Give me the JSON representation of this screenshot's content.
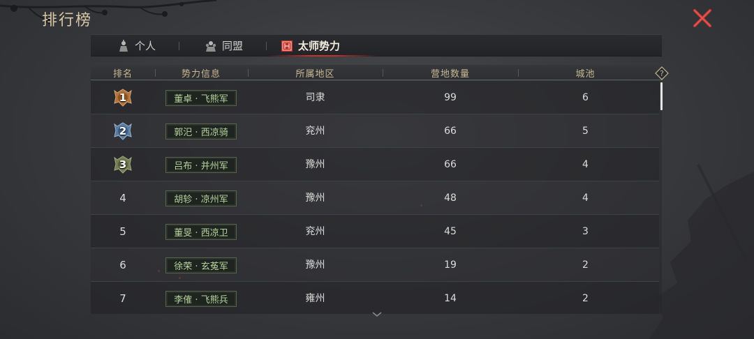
{
  "page": {
    "title": "排行榜"
  },
  "tabs": [
    {
      "label": "个人",
      "icon": "soldier-icon",
      "active": false
    },
    {
      "label": "同盟",
      "icon": "alliance-icon",
      "active": false
    },
    {
      "label": "太师势力",
      "icon": "banner-icon",
      "active": true
    }
  ],
  "table": {
    "headers": [
      "排名",
      "势力信息",
      "所属地区",
      "营地数量",
      "城池"
    ],
    "rows": [
      {
        "rank": "1",
        "medal": "gold",
        "force": "董卓 · 飞熊军",
        "region": "司隶",
        "camps": "99",
        "cities": "6"
      },
      {
        "rank": "2",
        "medal": "silver",
        "force": "郭汜 · 西凉骑",
        "region": "兖州",
        "camps": "66",
        "cities": "5"
      },
      {
        "rank": "3",
        "medal": "bronze",
        "force": "吕布 · 并州军",
        "region": "豫州",
        "camps": "66",
        "cities": "4"
      },
      {
        "rank": "4",
        "medal": "",
        "force": "胡轸 · 凉州军",
        "region": "豫州",
        "camps": "48",
        "cities": "4"
      },
      {
        "rank": "5",
        "medal": "",
        "force": "董旻 · 西凉卫",
        "region": "兖州",
        "camps": "45",
        "cities": "3"
      },
      {
        "rank": "6",
        "medal": "",
        "force": "徐荣 · 玄菟军",
        "region": "豫州",
        "camps": "19",
        "cities": "2"
      },
      {
        "rank": "7",
        "medal": "",
        "force": "李傕 · 飞熊兵",
        "region": "雍州",
        "camps": "14",
        "cities": "2"
      }
    ]
  },
  "colors": {
    "accent_red": "#c8302a",
    "header_text": "#c7b894",
    "force_text": "#b5d39a",
    "gold_medal": "#c98a4a",
    "silver_medal": "#6e8fb6",
    "bronze_medal": "#8c9668"
  }
}
